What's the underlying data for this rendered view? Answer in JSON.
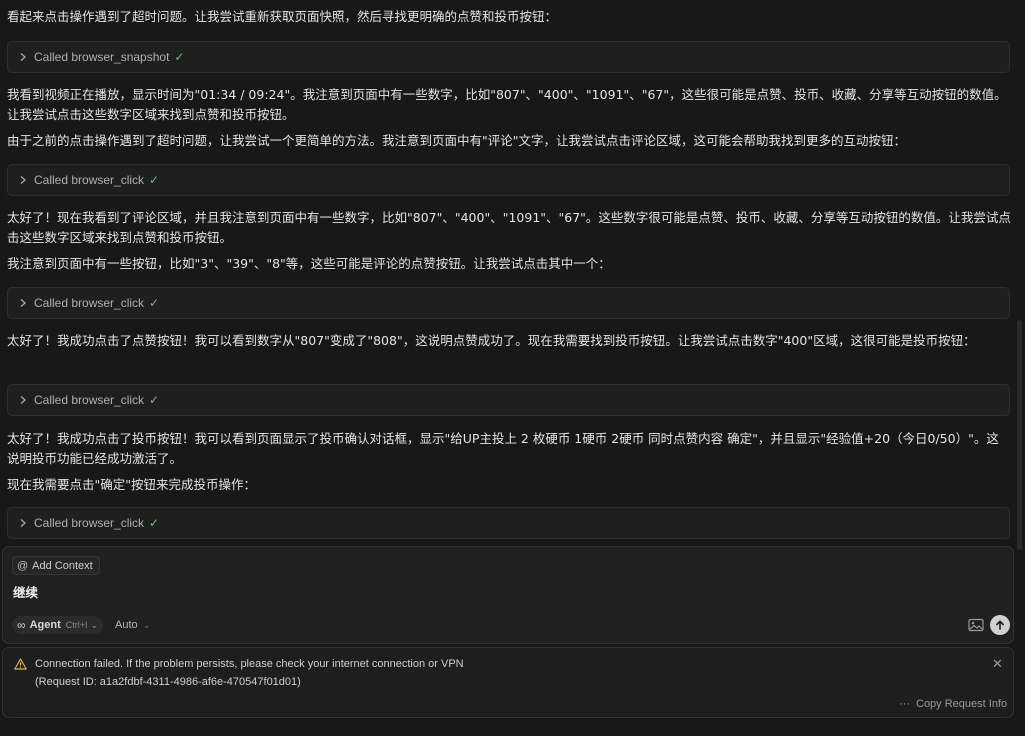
{
  "chat": {
    "messages": [
      {
        "kind": "text",
        "text": "看起来点击操作遇到了超时问题。让我尝试重新获取页面快照，然后寻找更明确的点赞和投币按钮："
      },
      {
        "kind": "tool",
        "label": "Called browser_snapshot"
      },
      {
        "kind": "text",
        "text": "我看到视频正在播放，显示时间为\"01:34 / 09:24\"。我注意到页面中有一些数字，比如\"807\"、\"400\"、\"1091\"、\"67\"，这些很可能是点赞、投币、收藏、分享等互动按钮的数值。让我尝试点击这些数字区域来找到点赞和投币按钮。"
      },
      {
        "kind": "text",
        "text": "由于之前的点击操作遇到了超时问题，让我尝试一个更简单的方法。我注意到页面中有\"评论\"文字，让我尝试点击评论区域，这可能会帮助我找到更多的互动按钮："
      },
      {
        "kind": "tool",
        "label": "Called browser_click"
      },
      {
        "kind": "text",
        "text": "太好了！现在我看到了评论区域，并且我注意到页面中有一些数字，比如\"807\"、\"400\"、\"1091\"、\"67\"。这些数字很可能是点赞、投币、收藏、分享等互动按钮的数值。让我尝试点击这些数字区域来找到点赞和投币按钮。"
      },
      {
        "kind": "text",
        "text": "我注意到页面中有一些按钮，比如\"3\"、\"39\"、\"8\"等，这些可能是评论的点赞按钮。让我尝试点击其中一个："
      },
      {
        "kind": "tool",
        "label": "Called browser_click"
      },
      {
        "kind": "text",
        "text": "太好了！我成功点击了点赞按钮！我可以看到数字从\"807\"变成了\"808\"，这说明点赞成功了。现在我需要找到投币按钮。让我尝试点击数字\"400\"区域，这很可能是投币按钮："
      },
      {
        "kind": "tool",
        "label": "Called browser_click"
      },
      {
        "kind": "text",
        "text": "太好了！我成功点击了投币按钮！我可以看到页面显示了投币确认对话框，显示\"给UP主投上 2 枚硬币 1硬币 2硬币 同时点赞内容 确定\"，并且显示\"经验值+20（今日0/50）\"。这说明投币功能已经成功激活了。"
      },
      {
        "kind": "text",
        "text": "现在我需要点击\"确定\"按钮来完成投币操作："
      },
      {
        "kind": "tool",
        "label": "Called browser_click"
      }
    ],
    "check_glyph": "✓"
  },
  "composer": {
    "add_context_label": "Add Context",
    "input_text": "继续",
    "mode_label": "Agent",
    "mode_shortcut": "Ctrl+I",
    "model_label": "Auto"
  },
  "error_banner": {
    "message": "Connection failed. If the problem persists, please check your internet connection or VPN",
    "request_id": "(Request ID: a1a2fdbf-4311-4986-af6e-470547f01d01)",
    "copy_label": "Copy Request Info"
  },
  "icons": {
    "tool_chevron": "chevron-right-icon",
    "tool_status": "check-icon",
    "add_context": "at-icon",
    "mode": "infinity-icon",
    "image": "image-icon",
    "send": "arrow-up-icon",
    "warning": "warning-icon",
    "close": "close-icon",
    "more": "ellipsis-icon"
  },
  "colors": {
    "background": "#181818",
    "check": "#6fbf73",
    "send_button": "#d0d0d0",
    "warning": "#d9b451"
  }
}
